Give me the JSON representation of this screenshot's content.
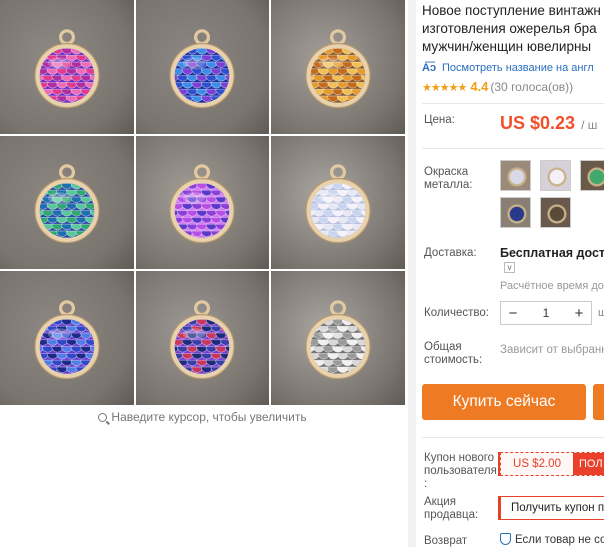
{
  "gallery": {
    "zoom_hint": "Наведите курсор, чтобы увеличить",
    "tiles": [
      {
        "bg": "#8e8a86",
        "scale_colors": [
          "#e23a8f",
          "#b12ea0",
          "#f06bb7",
          "#6a2cc4"
        ]
      },
      {
        "bg": "#8c8784",
        "scale_colors": [
          "#2d4fd0",
          "#3b8de8",
          "#7b3fd6",
          "#1b2e9e"
        ]
      },
      {
        "bg": "#a39f9a",
        "scale_colors": [
          "#e59a2a",
          "#c46a1a",
          "#f2c052",
          "#8a5a2a"
        ]
      },
      {
        "bg": "#8b8680",
        "scale_colors": [
          "#2fa872",
          "#1d6fb0",
          "#58c89a",
          "#2a4aa0"
        ]
      },
      {
        "bg": "#a29d97",
        "scale_colors": [
          "#8a3fd8",
          "#b74fe6",
          "#5a38c8",
          "#d078f0"
        ]
      },
      {
        "bg": "#aaa6a2",
        "scale_colors": [
          "#e8e8f4",
          "#c8d4f0",
          "#f6f0f8",
          "#b8c0e0"
        ]
      },
      {
        "bg": "#8d8884",
        "scale_colors": [
          "#2e48c8",
          "#1d2a8a",
          "#4f7fe6",
          "#6a3ad0"
        ]
      },
      {
        "bg": "#9c9894",
        "scale_colors": [
          "#3a3fa8",
          "#c8385e",
          "#1e2a7a",
          "#7a3ad0"
        ]
      },
      {
        "bg": "#a9a5a1",
        "scale_colors": [
          "#d8d8d8",
          "#9a9a9a",
          "#f0f0f0",
          "#707070"
        ]
      }
    ]
  },
  "product": {
    "title_lines": [
      "Новое поступление винтажн",
      "изготовления ожерелья бра",
      "мужчин/женщин ювелирны"
    ],
    "translate_link": "Посмотреть название на англ",
    "translate_icon": "translate-icon",
    "rating_value": "4.4",
    "votes": "(30 голоса(ов))",
    "stars": "★★★★★"
  },
  "labels": {
    "price": "Цена:",
    "metal": "Окраска металла:",
    "shipping": "Доставка:",
    "quantity": "Количество:",
    "total": "Общая стоимость:",
    "coupon": "Купон нового пользователя :",
    "promo": "Акция продавца:",
    "return": "Возврат"
  },
  "price": {
    "value": "US $0.23",
    "unit": "/ ш"
  },
  "metal_swatches": [
    {
      "bg": "#9a8a7a",
      "accent": "#d8d8e8"
    },
    {
      "bg": "#d6d0d8",
      "accent": "#f4f0f8"
    },
    {
      "bg": "#6a5a4a",
      "accent": "#3fa86a"
    },
    {
      "bg": "#8a7f74",
      "accent": "#2a3a8a"
    },
    {
      "bg": "#6a5a4e",
      "accent": "#5a4a3a"
    }
  ],
  "shipping": {
    "value": "Бесплатная достав",
    "time": "Расчётное время дос",
    "dropdown": "v"
  },
  "quantity": {
    "minus": "−",
    "value": "1",
    "plus": "+",
    "unit": "ш"
  },
  "total": {
    "value": "Зависит от выбранн"
  },
  "buy_button": "Купить сейчас",
  "coupon": {
    "amount": "US $2.00",
    "tag": "ПОЛ"
  },
  "promo": {
    "text": "Получить купон п"
  },
  "return": {
    "text": "Если товар не со"
  },
  "colors": {
    "accent": "#ef7a24",
    "price": "#f0512a",
    "star": "#f0a018",
    "link": "#2a6ebd",
    "coupon_red": "#e8402a"
  }
}
